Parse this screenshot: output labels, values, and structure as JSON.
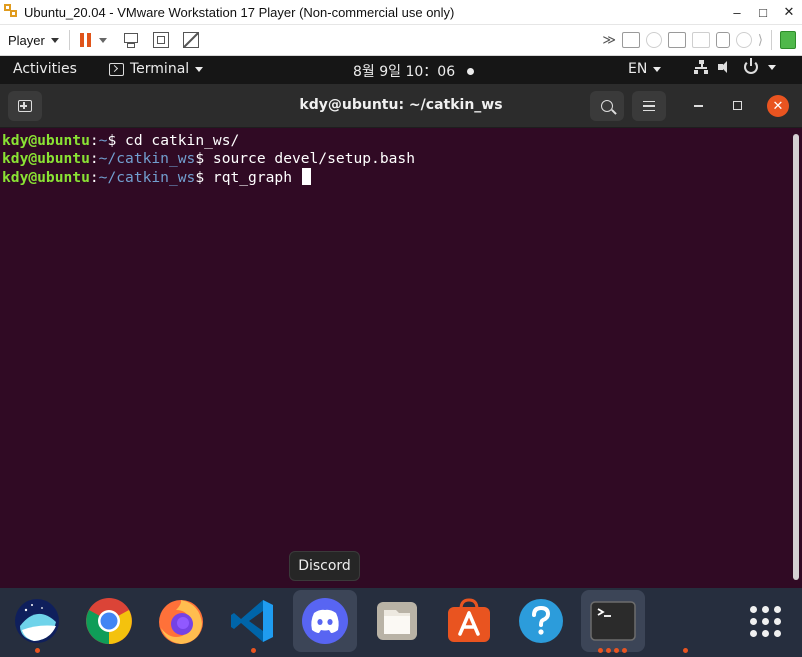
{
  "vmware": {
    "title": "Ubuntu_20.04 - VMware Workstation 17 Player (Non-commercial use only)",
    "controls": {
      "minimize": "–",
      "maximize": "□",
      "close": "✕"
    },
    "toolbar": {
      "player_menu": "Player"
    }
  },
  "topbar": {
    "activities": "Activities",
    "app_menu": "Terminal",
    "clock": "8월 9일  10：06",
    "language": "EN"
  },
  "terminal": {
    "title": "kdy@ubuntu: ~/catkin_ws",
    "close_glyph": "✕",
    "lines": [
      {
        "user": "kdy@ubuntu",
        "sep": ":",
        "path": "~",
        "prompt": "$ ",
        "command": "cd catkin_ws/"
      },
      {
        "user": "kdy@ubuntu",
        "sep": ":",
        "path": "~/catkin_ws",
        "prompt": "$ ",
        "command": "source devel/setup.bash"
      },
      {
        "user": "kdy@ubuntu",
        "sep": ":",
        "path": "~/catkin_ws",
        "prompt": "$ ",
        "command": "rqt_graph "
      }
    ],
    "colors": {
      "background": "#300a24",
      "user": "#8ae234",
      "path": "#729fcf",
      "accent": "#e95420"
    }
  },
  "tooltip": {
    "text": "Discord"
  },
  "dock": {
    "items": [
      {
        "icon": "naver-whale-icon",
        "running": true
      },
      {
        "icon": "chrome-icon",
        "running": false
      },
      {
        "icon": "firefox-icon",
        "running": false
      },
      {
        "icon": "vscode-icon",
        "running": true
      },
      {
        "icon": "discord-icon",
        "running": false,
        "hovered": true
      },
      {
        "icon": "files-icon",
        "running": false
      },
      {
        "icon": "software-center-icon",
        "running": false
      },
      {
        "icon": "help-icon",
        "running": false
      },
      {
        "icon": "terminal-icon",
        "running": true,
        "active": true
      },
      {
        "icon": "show-apps-icon",
        "running": false
      }
    ]
  }
}
